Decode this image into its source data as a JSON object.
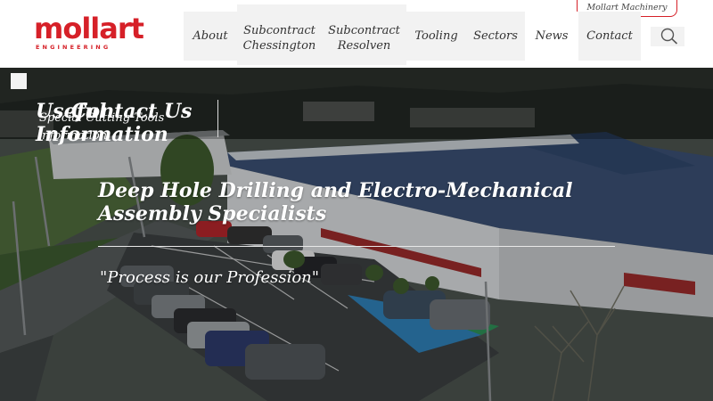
{
  "brand": {
    "name": "mollart",
    "subtitle": "ENGINEERING",
    "color": "#d62028"
  },
  "utility": {
    "machinery_link": "Mollart Machinery"
  },
  "nav": {
    "about": "About",
    "chessington_line1": "Subcontract",
    "chessington_line2": "Chessington",
    "resolven_line1": "Subcontract",
    "resolven_line2": "Resolven",
    "tooling": "Tooling",
    "sectors": "Sectors",
    "news": "News",
    "contact": "Contact"
  },
  "search": {
    "icon": "search-icon"
  },
  "hero": {
    "overlap_texts": [
      "Contact Us",
      "Useful",
      "Information",
      "Special Cutting Tools",
      "Information"
    ],
    "headline": "Deep Hole Drilling and Electro-Mechanical Assembly Specialists",
    "tagline": "\"Process is our Profession\""
  }
}
